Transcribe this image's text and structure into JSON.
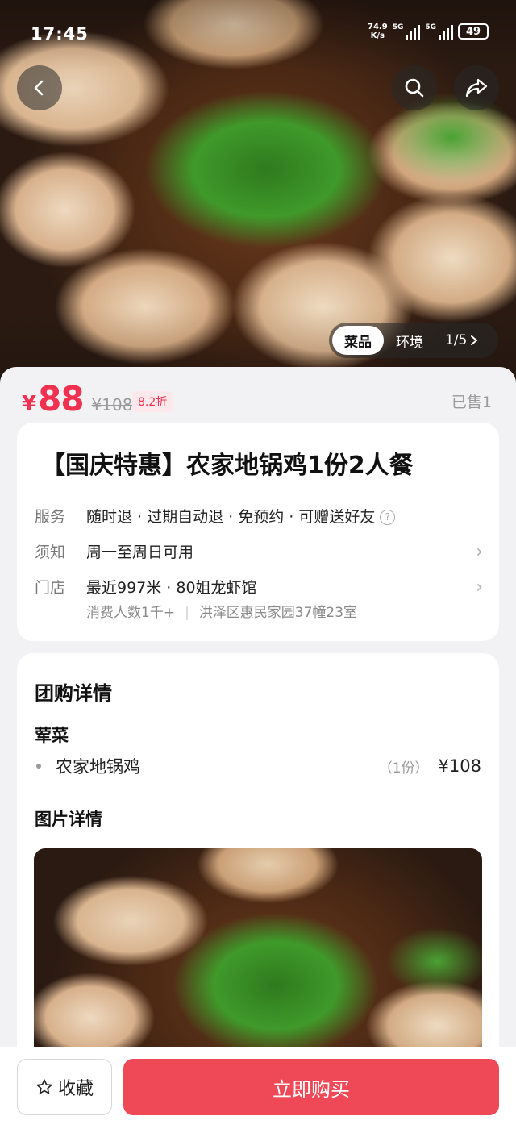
{
  "status_bar": {
    "time": "17:45",
    "net_speed_value": "74.9",
    "net_speed_unit": "K/s",
    "signal_1": "5G",
    "signal_2": "5G",
    "battery": "49"
  },
  "gallery": {
    "tabs": [
      "菜品",
      "环境"
    ],
    "active_tab": "菜品",
    "counter": "1/5"
  },
  "price": {
    "currency": "¥",
    "current": "88",
    "original": "¥108",
    "discount": "8.2折",
    "sold": "已售1"
  },
  "deal": {
    "title": "【国庆特惠】农家地锅鸡1份2人餐",
    "service_label": "服务",
    "service_value": "随时退 · 过期自动退 · 免预约 · 可赠送好友",
    "notice_label": "须知",
    "notice_value": "周一至周日可用",
    "store_label": "门店",
    "store_value": "最近997米 · 80姐龙虾馆",
    "consumers": "消费人数1千+",
    "address": "洪泽区惠民家园37幢23室"
  },
  "details": {
    "section_title": "团购详情",
    "category": "荤菜",
    "items": [
      {
        "name": "农家地锅鸡",
        "qty": "（1份）",
        "price": "¥108"
      }
    ],
    "images_title": "图片详情"
  },
  "bottom": {
    "favorite_label": "收藏",
    "buy_label": "立即购买"
  },
  "colors": {
    "accent": "#f0314f",
    "buy_button": "#ef4856"
  }
}
